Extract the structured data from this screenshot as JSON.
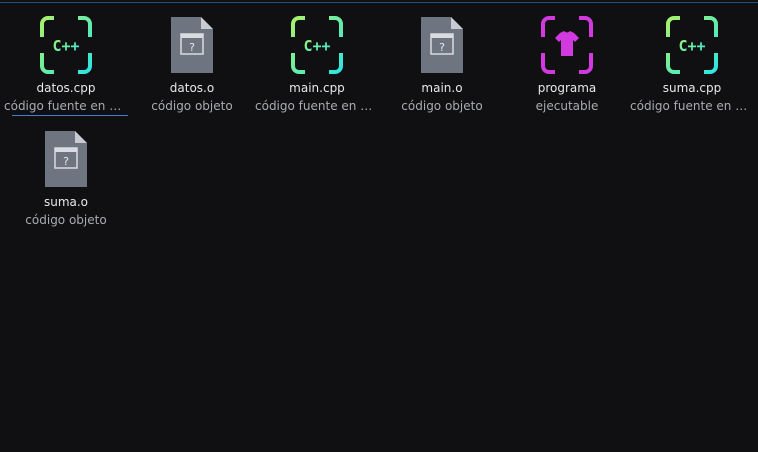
{
  "files": [
    {
      "name": "datos.cpp",
      "type": "código fuente en C++",
      "icon": "cpp-source-icon"
    },
    {
      "name": "datos.o",
      "type": "código objeto",
      "icon": "object-file-icon"
    },
    {
      "name": "main.cpp",
      "type": "código fuente en C++",
      "icon": "cpp-source-icon"
    },
    {
      "name": "main.o",
      "type": "código objeto",
      "icon": "object-file-icon"
    },
    {
      "name": "programa",
      "type": "ejecutable",
      "icon": "executable-icon"
    },
    {
      "name": "suma.cpp",
      "type": "código fuente en C++",
      "icon": "cpp-source-icon"
    },
    {
      "name": "suma.o",
      "type": "código objeto",
      "icon": "object-file-icon"
    }
  ],
  "colors": {
    "background": "#101013",
    "cpp_gradient_start": "#a8f26c",
    "cpp_gradient_end": "#2de6e0",
    "executable": "#d13adf",
    "object_file": "#6f7580",
    "selection": "#3d7fd0"
  }
}
